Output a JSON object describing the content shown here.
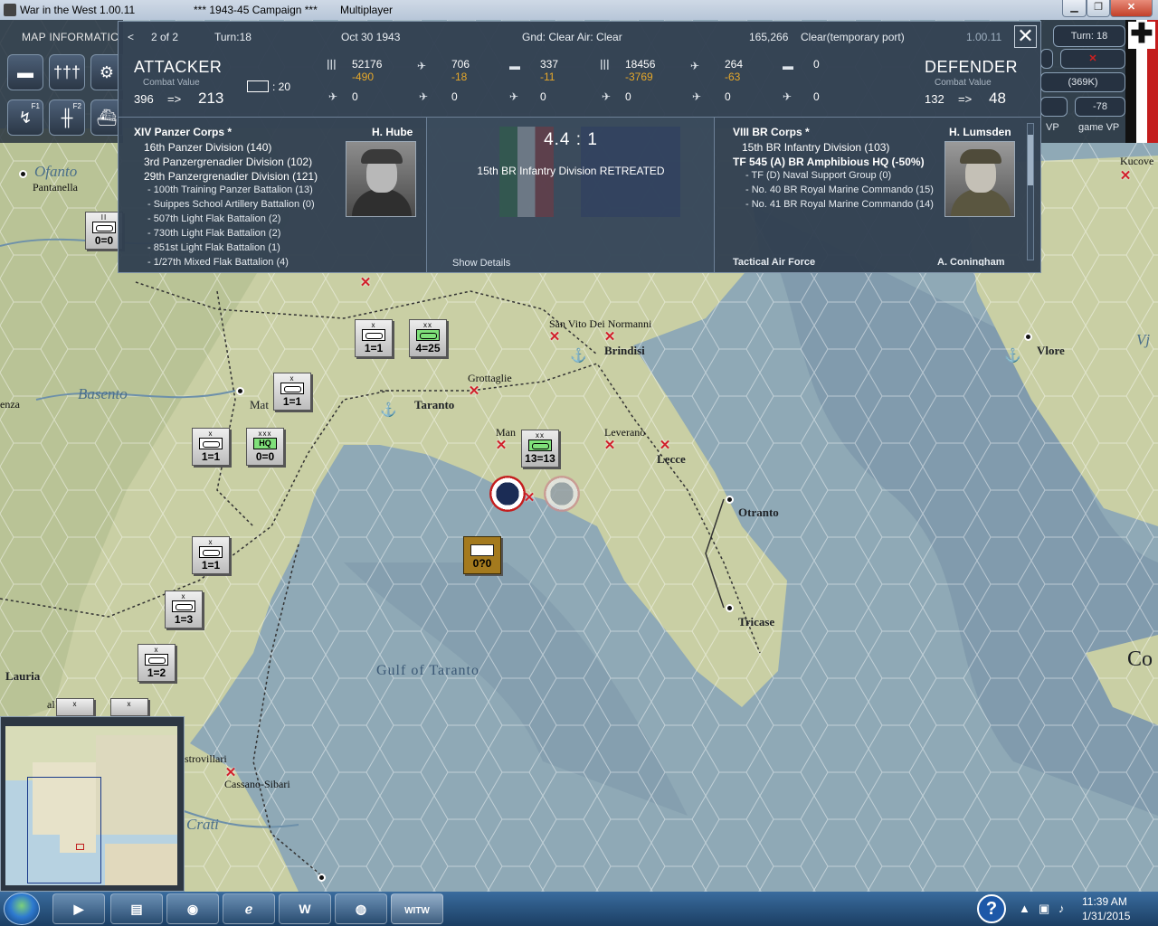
{
  "window": {
    "app_title": "War in the West 1.00.11",
    "campaign": "***   1943-45 Campaign   ***",
    "mode": "Multiplayer",
    "min_glyph": "▁",
    "max_glyph": "❐",
    "close_glyph": "✕"
  },
  "map_info_label": "MAP INFORMATIC",
  "toolbar_keys": {
    "f1": "F1",
    "f2": "F2"
  },
  "hud": {
    "turn": "Turn: 18",
    "supply": "(369K)",
    "score": "-78",
    "vp_label": "VP",
    "game_vp_label": "game VP"
  },
  "combat": {
    "nav_prev": "<",
    "page": "2 of 2",
    "turn": "Turn:18",
    "date": "Oct 30 1943",
    "weather": "Gnd: Clear  Air: Clear",
    "location_code": "165,266",
    "terrain": "Clear(temporary port)",
    "version": "1.00.11",
    "close": "✕",
    "attacker": {
      "title": "ATTACKER",
      "cv_label": "Combat Value",
      "cv_before": "396",
      "arrow": "=>",
      "cv_after": "213",
      "fort": ": 20",
      "men": "52176",
      "men_loss": "-490",
      "air": "706",
      "air_loss": "-18",
      "afv": "337",
      "afv_loss": "-11",
      "r2a": "0",
      "r2b": "0",
      "r2c": "0",
      "corps": "XIV Panzer Corps *",
      "commander": "H. Hube",
      "units": [
        "16th Panzer Division (140)",
        "3rd Panzergrenadier Division (102)",
        "29th Panzergrenadier Division (121)"
      ],
      "subunits": [
        "- 100th Training Panzer Battalion (13)",
        "- Suippes School Artillery Battalion (0)",
        "- 507th Light Flak Battalion (2)",
        "- 730th Light Flak Battalion (2)",
        "- 851st Light Flak Battalion (1)",
        "- 1/27th Mixed Flak Battalion (4)"
      ]
    },
    "defender": {
      "title": "DEFENDER",
      "cv_label": "Combat Value",
      "cv_before": "132",
      "arrow": "=>",
      "cv_after": "48",
      "men": "18456",
      "men_loss": "-3769",
      "air": "264",
      "air_loss": "-63",
      "afv": "0",
      "r2a": "0",
      "r2b": "0",
      "r2c": "0",
      "corps": "VIII BR Corps *",
      "commander": "H. Lumsden",
      "unit1": "15th BR Infantry Division (103)",
      "unit2": "TF 545 (A) BR Amphibious HQ (-50%)",
      "subunits": [
        "- TF (D) Naval Support Group (0)",
        "- No. 40 BR Royal Marine Commando (15)",
        "- No. 41 BR Royal Marine Commando (14)"
      ],
      "tactical_air": "Tactical Air Force",
      "tactical_air_cmdr": "A. Coningham"
    },
    "odds": "4.4 : 1",
    "result": "15th BR Infantry Division RETREATED",
    "show_details": "Show Details"
  },
  "map": {
    "towns": {
      "ofanto": "Ofanto",
      "pantanella": "Pantanella",
      "basento": "Basento",
      "enza": "enza",
      "mat": "Mat",
      "taranto": "Taranto",
      "grottaglie": "Grottaglie",
      "sanvito": "San Vito Dei Normanni",
      "brindisi": "Brindisi",
      "man": "Man",
      "leverano": "Leverano",
      "lecce": "Lecce",
      "otranto": "Otranto",
      "tricase": "Tricase",
      "gulf": "Gulf of Taranto",
      "lauria": "Lauria",
      "al": "al",
      "strovillari": "strovillari",
      "cassano": "Cassano-Sibari",
      "crati": "Crati",
      "vlore": "Vlore",
      "vj": "Vj",
      "kucove": "Kucove",
      "co": "Co"
    },
    "counters": {
      "c1": {
        "size": "x",
        "str": "1=1"
      },
      "c2": {
        "size": "xx",
        "str": "4=25"
      },
      "c3": {
        "size": "x",
        "str": "1=1"
      },
      "c4": {
        "size": "x",
        "str": "1=1"
      },
      "c5": {
        "size": "xxx",
        "sym": "HQ",
        "str": "0=0"
      },
      "c6": {
        "size": "xx",
        "str": "13=13"
      },
      "c7": {
        "size": "x",
        "str": "1=1"
      },
      "c8": {
        "size": "x",
        "str": "1=3"
      },
      "c9": {
        "size": "x",
        "str": "1=2"
      },
      "c10": {
        "size": "II",
        "str": "0=0"
      },
      "c11": {
        "size": "",
        "str": "0?0"
      },
      "c12": {
        "size": "x",
        "str": ""
      },
      "c13": {
        "size": "x",
        "str": ""
      }
    }
  },
  "taskbar": {
    "help": "?",
    "word": "W",
    "witw": "WITW",
    "time": "11:39 AM",
    "date": "1/31/2015"
  }
}
